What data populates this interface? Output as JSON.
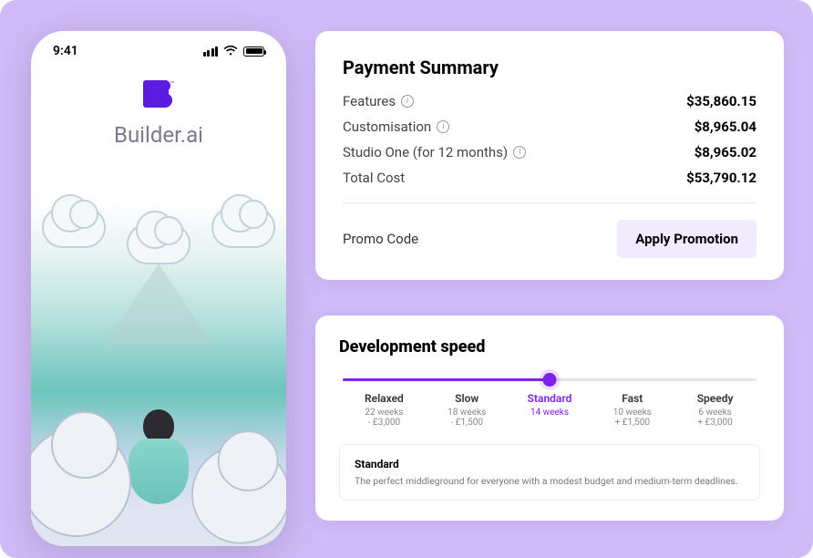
{
  "phone": {
    "time": "9:41",
    "brand": "Builder.ai"
  },
  "payment": {
    "title": "Payment Summary",
    "rows": [
      {
        "label": "Features",
        "info": true,
        "value": "$35,860.15"
      },
      {
        "label": "Customisation",
        "info": true,
        "value": "$8,965.04"
      },
      {
        "label": "Studio One (for 12 months)",
        "info": true,
        "value": "$8,965.02"
      },
      {
        "label": "Total Cost",
        "info": false,
        "value": "$53,790.12"
      }
    ],
    "promo_label": "Promo Code",
    "apply_label": "Apply Promotion"
  },
  "speed": {
    "title": "Development speed",
    "active_index": 2,
    "options": [
      {
        "name": "Relaxed",
        "duration": "22 weeks",
        "price": "- £3,000"
      },
      {
        "name": "Slow",
        "duration": "18 weeks",
        "price": "- £1,500"
      },
      {
        "name": "Standard",
        "duration": "14 weeks",
        "price": ""
      },
      {
        "name": "Fast",
        "duration": "10 weeks",
        "price": "+ £1,500"
      },
      {
        "name": "Speedy",
        "duration": "6 weeks",
        "price": "+ £3,000"
      }
    ],
    "desc_title": "Standard",
    "desc_text": "The perfect middleground for everyone with a modest budget and medium-term deadlines."
  },
  "colors": {
    "accent": "#7b23e8",
    "bg": "#d0baf8"
  }
}
